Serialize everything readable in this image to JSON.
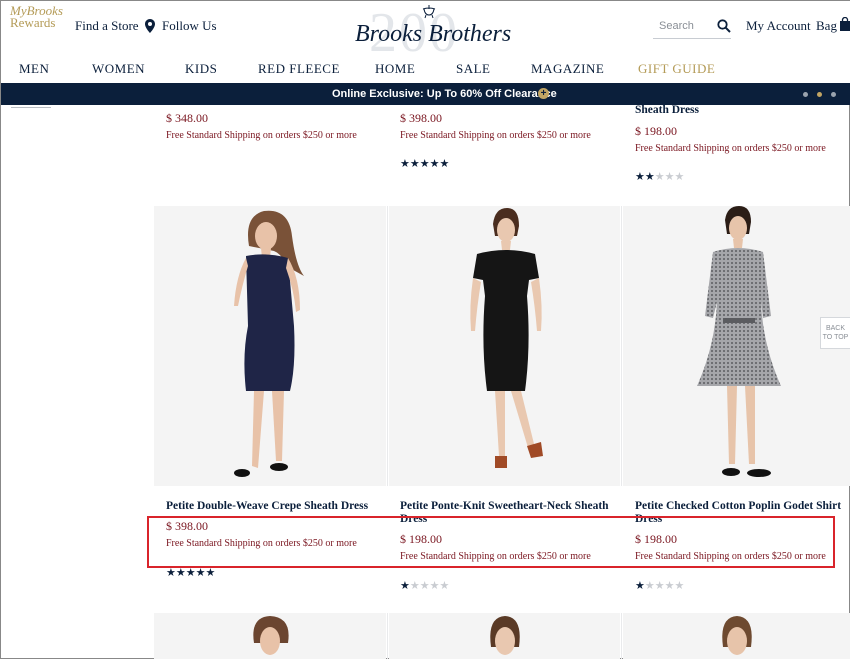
{
  "header": {
    "rewards": {
      "my": "My",
      "brooks": "Brooks",
      "rewards": "Rewards"
    },
    "find_store": "Find a Store",
    "follow_us": "Follow Us",
    "logo": {
      "bg": "200",
      "name": "Brooks Brothers"
    },
    "search_placeholder": "Search",
    "my_account": "My Account",
    "bag": "Bag"
  },
  "nav": {
    "items": [
      "MEN",
      "WOMEN",
      "KIDS",
      "RED FLEECE",
      "HOME",
      "SALE",
      "MAGAZINE",
      "GIFT GUIDE"
    ]
  },
  "promo": {
    "text": "Online Exclusive: Up To 60% Off Clearance",
    "plus": "+"
  },
  "top_row": [
    {
      "price": "$ 348.00",
      "shipping": "Free Standard Shipping on orders $250 or more",
      "rating": null
    },
    {
      "price": "$ 398.00",
      "shipping": "Free Standard Shipping on orders $250 or more",
      "rating": 5
    },
    {
      "name_tail": "Sheath Dress",
      "price": "$ 198.00",
      "shipping": "Free Standard Shipping on orders $250 or more",
      "rating": 2
    }
  ],
  "products": [
    {
      "name": "Petite Double-Weave Crepe Sheath Dress",
      "name_line2": "",
      "price": "$ 398.00",
      "shipping": "Free Standard Shipping on orders $250 or more",
      "rating": 5,
      "dress_color": "#1f2547"
    },
    {
      "name": "Petite Ponte-Knit Sweetheart-Neck Sheath",
      "name_line2": "Dress",
      "price": "$ 198.00",
      "shipping": "Free Standard Shipping on orders $250 or more",
      "rating": 1,
      "dress_color": "#151515"
    },
    {
      "name": "Petite Checked Cotton Poplin Godet Shirt",
      "name_line2": "Dress",
      "price": "$ 198.00",
      "shipping": "Free Standard Shipping on orders $250 or more",
      "rating": 1,
      "dress_color": "#8c8d91"
    }
  ],
  "back_to_top": {
    "line1": "BACK",
    "line2": "TO TOP"
  },
  "colors": {
    "navy": "#0b1f3b",
    "gold": "#b49b57",
    "maroon": "#7a1620",
    "highlight": "#d9242b"
  }
}
